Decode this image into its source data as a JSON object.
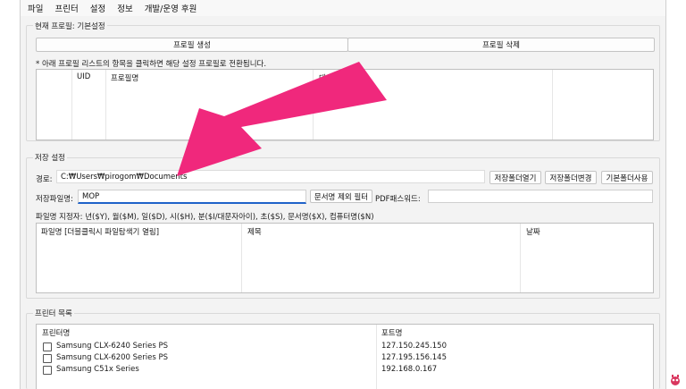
{
  "menu": [
    "파일",
    "프린터",
    "설정",
    "정보",
    "개발/운영 후원"
  ],
  "profile": {
    "title": "현재 프로필: 기본설정",
    "create_label": "프로필 생성",
    "delete_label": "프로필 삭제",
    "hint": "* 아래 프로필 리스트의 항목을 클릭하면 해당 설정 프로필로 전환됩니다.",
    "columns": [
      "UID",
      "프로필명",
      "대상"
    ]
  },
  "save": {
    "title": "저장 설정",
    "path_label": "경로:",
    "path_value": "C:₩Users₩pirogom₩Documents",
    "open_folder_label": "저장폴더열기",
    "change_folder_label": "저장폴더변경",
    "default_folder_label": "기본폴더사용",
    "filename_label": "저장파일명:",
    "filename_value": "MOP",
    "doc_filter_label": "문서명 제외 필터",
    "pdf_password_label": "PDF패스워드:",
    "pdf_password_value": "",
    "spec_hint": "파일명 지정자: 년($Y), 월($M), 일($D), 시($H), 분($I/대문자아이), 초($S), 문서명($X), 컴퓨터명($N)",
    "columns": [
      "파일명 [더블클릭시 파일탐색기 열림]",
      "제목",
      "날짜"
    ]
  },
  "printers": {
    "title": "프린터 목록",
    "columns": [
      "프린터명",
      "포트명"
    ],
    "rows": [
      {
        "name": "Samsung CLX-6240 Series PS",
        "port": "127.150.245.150"
      },
      {
        "name": "Samsung CLX-6200 Series PS",
        "port": "127.195.156.145"
      },
      {
        "name": "Samsung C51x Series",
        "port": "192.168.0.167"
      }
    ]
  },
  "colors": {
    "arrow": "#f0287c",
    "focus": "#1f62c9",
    "window_bg": "#f3f3f3"
  }
}
